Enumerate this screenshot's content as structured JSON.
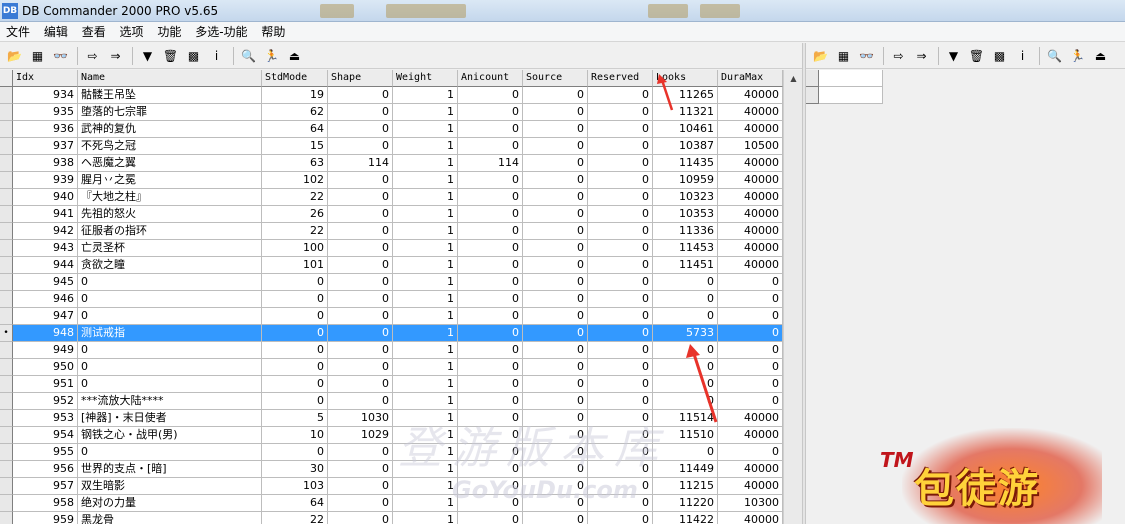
{
  "window": {
    "title": "DB Commander 2000 PRO v5.65"
  },
  "menu": [
    "文件",
    "编辑",
    "查看",
    "选项",
    "功能",
    "多选-功能",
    "帮助"
  ],
  "toolbar": {
    "buttons": [
      {
        "icon": "open-folder-icon",
        "glyph": "📂"
      },
      {
        "icon": "table-grid-icon",
        "glyph": "▦"
      },
      {
        "icon": "glasses-icon",
        "glyph": "👓"
      },
      {
        "icon": "arrow-right-icon",
        "glyph": "⇨"
      },
      {
        "icon": "export-icon",
        "glyph": "⇒"
      },
      {
        "icon": "filter-icon",
        "glyph": "▼"
      },
      {
        "icon": "trash-icon",
        "glyph": "🗑"
      },
      {
        "icon": "grid-edit-icon",
        "glyph": "▩"
      },
      {
        "icon": "info-icon",
        "glyph": "i"
      },
      {
        "icon": "search-tools-icon",
        "glyph": "🔍"
      },
      {
        "icon": "run-icon",
        "glyph": "🏃"
      },
      {
        "icon": "exit-icon",
        "glyph": "⏏"
      }
    ]
  },
  "grid": {
    "columns": [
      "Idx",
      "Name",
      "StdMode",
      "Shape",
      "Weight",
      "Anicount",
      "Source",
      "Reserved",
      "Looks",
      "DuraMax"
    ],
    "rows": [
      [
        "934",
        "骷髅王吊坠",
        "19",
        "0",
        "1",
        "0",
        "0",
        "0",
        "11265",
        "40000"
      ],
      [
        "935",
        "堕落的七宗罪",
        "62",
        "0",
        "1",
        "0",
        "0",
        "0",
        "11321",
        "40000"
      ],
      [
        "936",
        "武神的复仇",
        "64",
        "0",
        "1",
        "0",
        "0",
        "0",
        "10461",
        "40000"
      ],
      [
        "937",
        "不死鸟之冠",
        "15",
        "0",
        "1",
        "0",
        "0",
        "0",
        "10387",
        "10500"
      ],
      [
        "938",
        "ヘ恶魔之翼",
        "63",
        "114",
        "1",
        "114",
        "0",
        "0",
        "11435",
        "40000"
      ],
      [
        "939",
        "腥月丷之冕",
        "102",
        "0",
        "1",
        "0",
        "0",
        "0",
        "10959",
        "40000"
      ],
      [
        "940",
        "『大地之柱』",
        "22",
        "0",
        "1",
        "0",
        "0",
        "0",
        "10323",
        "40000"
      ],
      [
        "941",
        "先祖的怒火",
        "26",
        "0",
        "1",
        "0",
        "0",
        "0",
        "10353",
        "40000"
      ],
      [
        "942",
        "征服者の指环",
        "22",
        "0",
        "1",
        "0",
        "0",
        "0",
        "11336",
        "40000"
      ],
      [
        "943",
        "亡灵圣杯",
        "100",
        "0",
        "1",
        "0",
        "0",
        "0",
        "11453",
        "40000"
      ],
      [
        "944",
        "贪欲之瞳",
        "101",
        "0",
        "1",
        "0",
        "0",
        "0",
        "11451",
        "40000"
      ],
      [
        "945",
        "0",
        "0",
        "0",
        "1",
        "0",
        "0",
        "0",
        "0",
        "0"
      ],
      [
        "946",
        "0",
        "0",
        "0",
        "1",
        "0",
        "0",
        "0",
        "0",
        "0"
      ],
      [
        "947",
        "0",
        "0",
        "0",
        "1",
        "0",
        "0",
        "0",
        "0",
        "0"
      ],
      [
        "948",
        "测试戒指",
        "0",
        "0",
        "1",
        "0",
        "0",
        "0",
        "5733",
        "0"
      ],
      [
        "949",
        "0",
        "0",
        "0",
        "1",
        "0",
        "0",
        "0",
        "0",
        "0"
      ],
      [
        "950",
        "0",
        "0",
        "0",
        "1",
        "0",
        "0",
        "0",
        "0",
        "0"
      ],
      [
        "951",
        "0",
        "0",
        "0",
        "1",
        "0",
        "0",
        "0",
        "0",
        "0"
      ],
      [
        "952",
        "***流放大陆****",
        "0",
        "0",
        "1",
        "0",
        "0",
        "0",
        "0",
        "0"
      ],
      [
        "953",
        "[神器]・末日使者",
        "5",
        "1030",
        "1",
        "0",
        "0",
        "0",
        "11514",
        "40000"
      ],
      [
        "954",
        "钢铁之心・战甲(男)",
        "10",
        "1029",
        "1",
        "0",
        "0",
        "0",
        "11510",
        "40000"
      ],
      [
        "955",
        "0",
        "0",
        "0",
        "1",
        "0",
        "0",
        "0",
        "0",
        "0"
      ],
      [
        "956",
        "世界的支点・[暗]",
        "30",
        "0",
        "1",
        "0",
        "0",
        "0",
        "11449",
        "40000"
      ],
      [
        "957",
        "双生暗影",
        "103",
        "0",
        "1",
        "0",
        "0",
        "0",
        "11215",
        "40000"
      ],
      [
        "958",
        "绝对の力量",
        "64",
        "0",
        "1",
        "0",
        "0",
        "0",
        "11220",
        "10300"
      ],
      [
        "959",
        "黑龙骨",
        "22",
        "0",
        "1",
        "0",
        "0",
        "0",
        "11422",
        "40000"
      ]
    ],
    "selected_idx": "948",
    "row_marker": "•"
  },
  "watermark": {
    "text": "登游版本库",
    "url": "GoYouDu.com"
  },
  "logo": {
    "tm": "TM",
    "brand": "包徒游"
  },
  "colors": {
    "selection": "#3399ff",
    "annotation_arrow": "#e8332a"
  }
}
